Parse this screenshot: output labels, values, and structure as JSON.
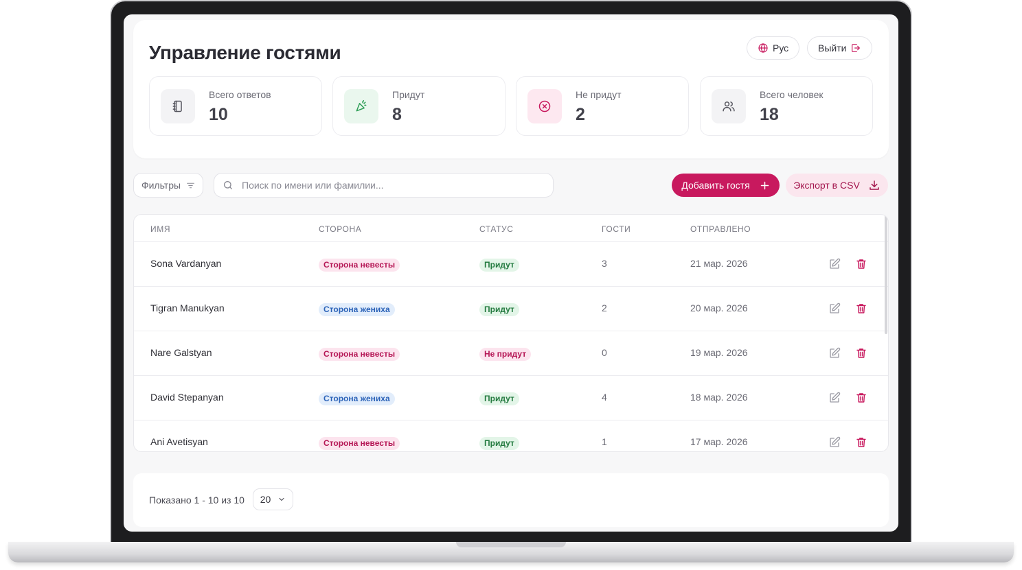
{
  "header": {
    "title": "Управление гостями",
    "lang_label": "Рус",
    "logout_label": "Выйти"
  },
  "stats": [
    {
      "label": "Всего ответов",
      "value": "10",
      "icon": "notebook-icon",
      "color": "#6b6b75",
      "bg": "#f3f3f5"
    },
    {
      "label": "Придут",
      "value": "8",
      "icon": "party-popper-icon",
      "color": "#2e9e56",
      "bg": "#eaf7ee"
    },
    {
      "label": "Не придут",
      "value": "2",
      "icon": "x-circle-icon",
      "color": "#c8195e",
      "bg": "#fde8f0"
    },
    {
      "label": "Всего человек",
      "value": "18",
      "icon": "users-icon",
      "color": "#55555e",
      "bg": "#f3f3f5"
    }
  ],
  "toolbar": {
    "filters_label": "Фильтры",
    "search_placeholder": "Поиск по имени или фамилии...",
    "add_label": "Добавить гостя",
    "export_label": "Экспорт в CSV"
  },
  "table": {
    "columns": [
      "ИМЯ",
      "СТОРОНА",
      "СТАТУС",
      "ГОСТИ",
      "ОТПРАВЛЕНО"
    ],
    "rows": [
      {
        "name": "Sona Vardanyan",
        "side": "Сторона невесты",
        "side_type": "bride",
        "status": "Придут",
        "status_type": "yes",
        "guests": "3",
        "sent": "21 мар. 2026"
      },
      {
        "name": "Tigran Manukyan",
        "side": "Сторона жениха",
        "side_type": "groom",
        "status": "Придут",
        "status_type": "yes",
        "guests": "2",
        "sent": "20 мар. 2026"
      },
      {
        "name": "Nare Galstyan",
        "side": "Сторона невесты",
        "side_type": "bride",
        "status": "Не придут",
        "status_type": "no",
        "guests": "0",
        "sent": "19 мар. 2026"
      },
      {
        "name": "David Stepanyan",
        "side": "Сторона жениха",
        "side_type": "groom",
        "status": "Придут",
        "status_type": "yes",
        "guests": "4",
        "sent": "18 мар. 2026"
      },
      {
        "name": "Ani Avetisyan",
        "side": "Сторона невесты",
        "side_type": "bride",
        "status": "Придут",
        "status_type": "yes",
        "guests": "1",
        "sent": "17 мар. 2026"
      }
    ]
  },
  "footer": {
    "shown_text": "Показано 1 - 10 из 10",
    "page_size": "20"
  },
  "colors": {
    "accent": "#c8195e",
    "accent_soft": "#fbe6ee"
  }
}
